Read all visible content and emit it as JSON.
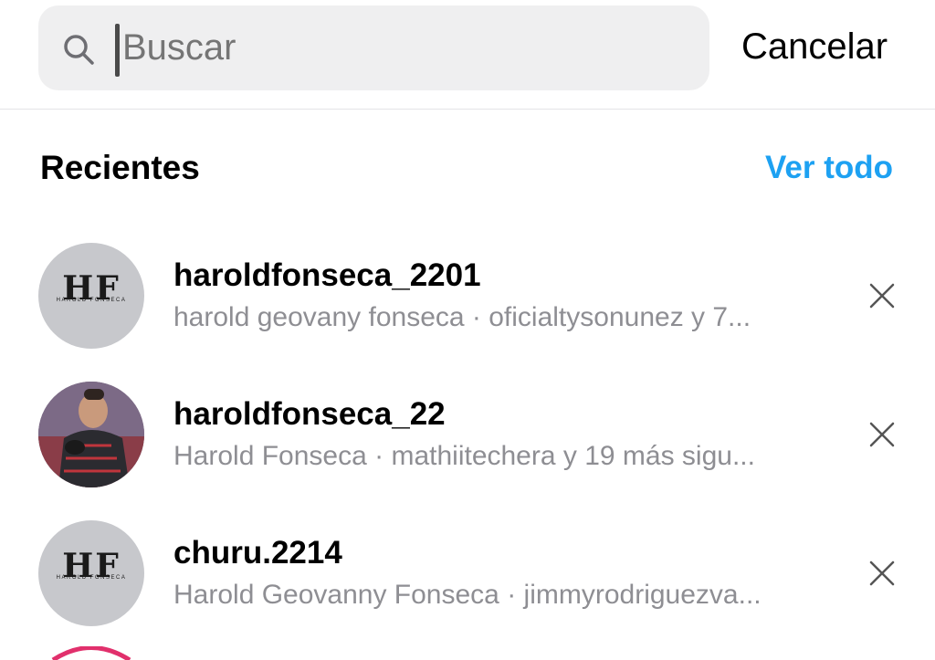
{
  "search": {
    "placeholder": "Buscar",
    "cancel_label": "Cancelar"
  },
  "recent": {
    "title": "Recientes",
    "see_all_label": "Ver todo",
    "items": [
      {
        "username": "haroldfonseca_2201",
        "name": "harold geovany fonseca",
        "followers": "oficialtysonunez y 7...",
        "avatar": "hf-logo",
        "avatar_text": "HF",
        "avatar_subtext": "HAROLD FONSECA"
      },
      {
        "username": "haroldfonseca_22",
        "name": "Harold Fonseca",
        "followers": "mathiitechera y 19 más sigu...",
        "avatar": "goalkeeper-photo"
      },
      {
        "username": "churu.2214",
        "name": "Harold Geovanny Fonseca",
        "followers": "jimmyrodriguezva...",
        "avatar": "hf-logo",
        "avatar_text": "HF",
        "avatar_subtext": "HAROLD FONSECA"
      }
    ]
  },
  "colors": {
    "accent": "#1da1f2",
    "secondary_text": "#8e8e93",
    "search_bg": "#efeff0"
  }
}
